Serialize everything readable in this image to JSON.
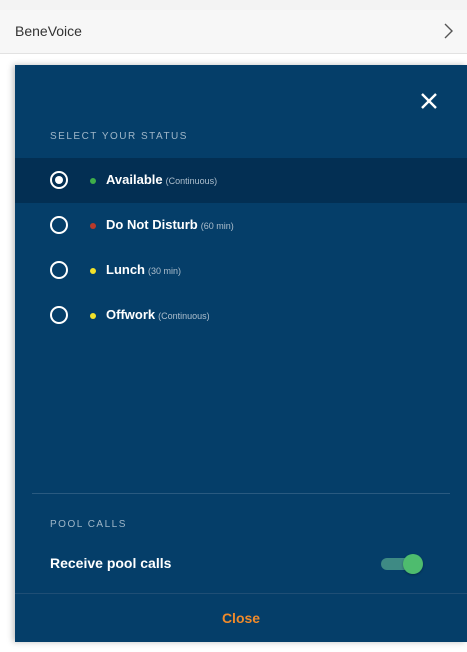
{
  "app": {
    "title": "BeneVoice"
  },
  "status": {
    "section_title": "SELECT YOUR STATUS",
    "selected_index": 0,
    "items": [
      {
        "label": "Available",
        "duration": "(Continuous)",
        "dot_color": "#3fae49",
        "selected": true
      },
      {
        "label": "Do Not Disturb",
        "duration": "(60 min)",
        "dot_color": "#b83a2a",
        "selected": false
      },
      {
        "label": "Lunch",
        "duration": "(30 min)",
        "dot_color": "#f2e12a",
        "selected": false
      },
      {
        "label": "Offwork",
        "duration": "(Continuous)",
        "dot_color": "#f2e12a",
        "selected": false
      }
    ]
  },
  "pool": {
    "section_title": "POOL CALLS",
    "receive_label": "Receive pool calls",
    "enabled": true
  },
  "footer": {
    "close_label": "Close"
  },
  "colors": {
    "panel_bg": "#053e69",
    "selected_row_bg": "#032f53",
    "accent_orange": "#f08a2a",
    "toggle_on": "#4ebc6e"
  },
  "icons": {
    "topbar_chevron": "chevron-right-icon",
    "panel_close": "close-icon"
  }
}
